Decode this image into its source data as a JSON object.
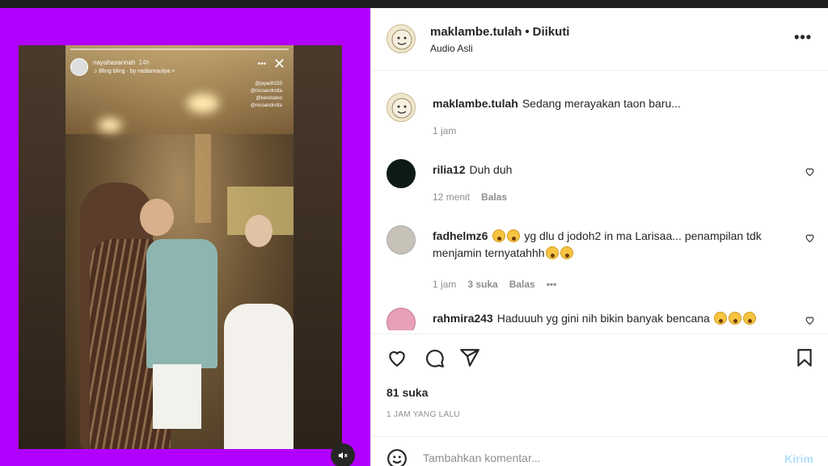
{
  "story": {
    "username": "nayahasannah",
    "time": "14h",
    "song": "♫ Bling bling  ·  by nadianraulya >",
    "tags": [
      "@jayadh233",
      "@nicoandrotta",
      "@kendodeo",
      "@nicoandrotta"
    ]
  },
  "post": {
    "username": "maklambe.tulah",
    "separator": "•",
    "follow_status": "Diikuti",
    "audio": "Audio Asli",
    "more_label": "•••"
  },
  "comments": [
    {
      "user": "maklambe.tulah",
      "text": "Sedang merayakan taon baru...",
      "time": "1 jam",
      "likes": "",
      "reply": ""
    },
    {
      "user": "rilia12",
      "text": "Duh duh",
      "time": "12 menit",
      "likes": "",
      "reply": "Balas"
    },
    {
      "user": "fadhelmz6",
      "text": "yg dlu d jodoh2 in ma Larisaa... penampilan tdk menjamin ternyatahhh",
      "time": "1 jam",
      "likes": "3 suka",
      "reply": "Balas"
    },
    {
      "user": "rahmira243",
      "text": "Haduuuh yg gini nih bikin banyak bencana",
      "time": "",
      "likes": "",
      "reply": ""
    }
  ],
  "engagement": {
    "likes": "81 suka",
    "date": "1 JAM YANG LALU"
  },
  "composer": {
    "placeholder": "Tambahkan komentar...",
    "post_label": "Kirim"
  },
  "icons": {
    "like": "heart-icon",
    "comment": "comment-icon",
    "share": "share-icon",
    "save": "bookmark-icon",
    "emoji": "smile-icon",
    "mute": "speaker-muted-icon"
  },
  "colors": {
    "media_background": "#b100ff",
    "post_button": "#b2dffc",
    "meta_text": "#8e8e8e"
  }
}
